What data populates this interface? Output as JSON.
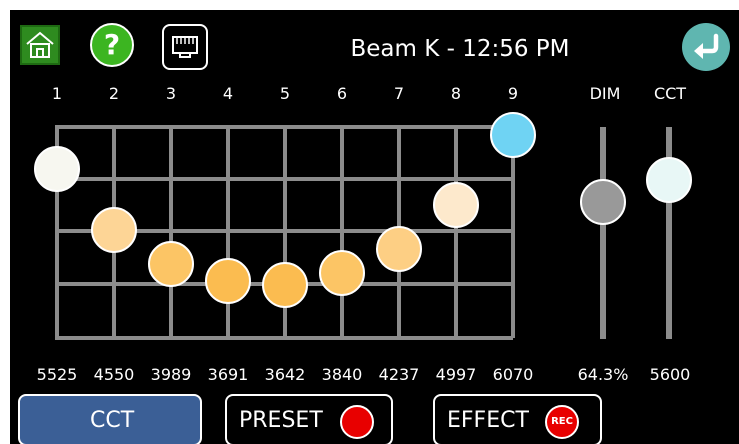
{
  "header": {
    "title": "Beam K - 12:56 PM",
    "icons": {
      "home": "home-icon",
      "help": "help-icon",
      "network": "ethernet-port-icon",
      "back": "back-arrow-icon"
    },
    "help_symbol": "?"
  },
  "channels": [
    {
      "label": "1",
      "value": "5525",
      "level": 0.8,
      "color": "#f7f7f0"
    },
    {
      "label": "2",
      "value": "4550",
      "level": 0.51,
      "color": "#fdd596"
    },
    {
      "label": "3",
      "value": "3989",
      "level": 0.35,
      "color": "#fcc565"
    },
    {
      "label": "4",
      "value": "3691",
      "level": 0.27,
      "color": "#fbbc50"
    },
    {
      "label": "5",
      "value": "3642",
      "level": 0.25,
      "color": "#fbbc50"
    },
    {
      "label": "6",
      "value": "3840",
      "level": 0.31,
      "color": "#fcc565"
    },
    {
      "label": "7",
      "value": "4237",
      "level": 0.42,
      "color": "#fdcf84"
    },
    {
      "label": "8",
      "value": "4997",
      "level": 0.63,
      "color": "#fde9cc"
    },
    {
      "label": "9",
      "value": "6070",
      "level": 0.96,
      "color": "#6fd3f3"
    }
  ],
  "dim": {
    "label": "DIM",
    "value": "64.3%",
    "level": 0.643,
    "color": "#999999"
  },
  "cct": {
    "label": "CCT",
    "value": "5600",
    "level": 0.75,
    "color": "#e8f7f6"
  },
  "buttons": {
    "cct_label": "CCT",
    "preset_label": "PRESET",
    "effect_label": "EFFECT",
    "rec_label": "REC"
  },
  "colors": {
    "accent_blue": "#3b5f96",
    "grid": "#8c8c8c",
    "record_red": "#e80000",
    "back_teal": "#5fb6b0",
    "home_green": "#2e8b1f"
  }
}
